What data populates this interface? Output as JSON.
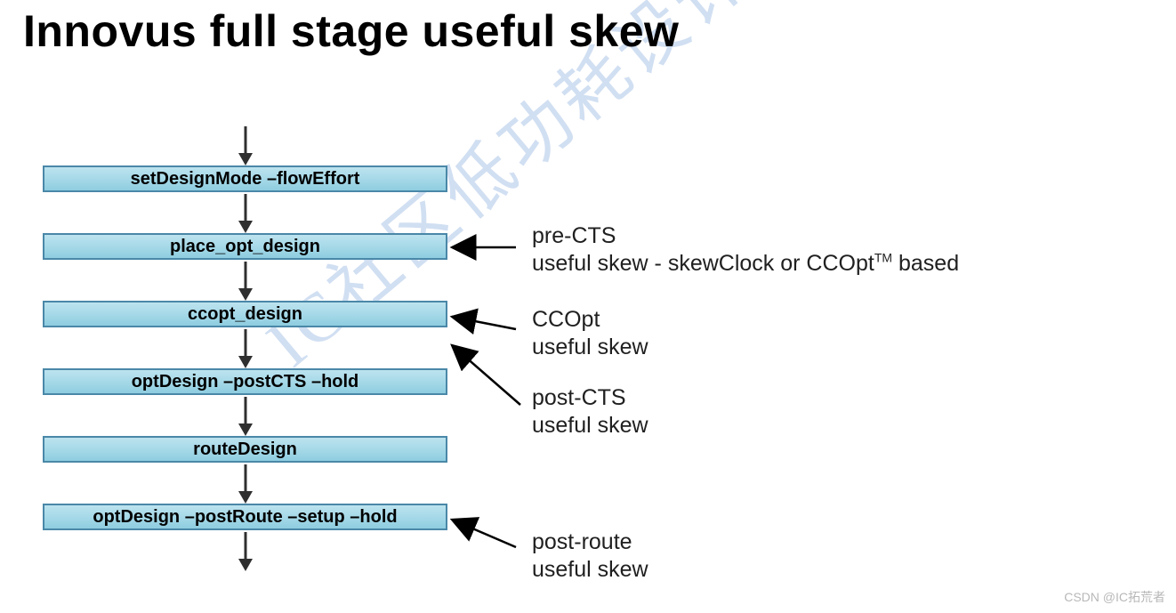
{
  "title": "Innovus full stage useful skew",
  "flow": {
    "steps": [
      {
        "label": "setDesignMode –flowEffort"
      },
      {
        "label": "place_opt_design"
      },
      {
        "label": "ccopt_design"
      },
      {
        "label": "optDesign –postCTS –hold"
      },
      {
        "label": "routeDesign"
      },
      {
        "label": "optDesign –postRoute –setup –hold"
      }
    ]
  },
  "annotations": {
    "a0": {
      "line1": "pre-CTS",
      "line2_pre": "useful skew - skewClock or CCOpt",
      "tm": "TM",
      "line2_post": " based"
    },
    "a1": {
      "line1": "CCOpt",
      "line2": "useful skew"
    },
    "a2": {
      "line1": "post-CTS",
      "line2": "useful skew"
    },
    "a3": {
      "line1": "post-route",
      "line2": "useful skew"
    },
    "credit": "CSDN @IC拓荒者",
    "watermark": "IC社区低功耗设计实现"
  }
}
